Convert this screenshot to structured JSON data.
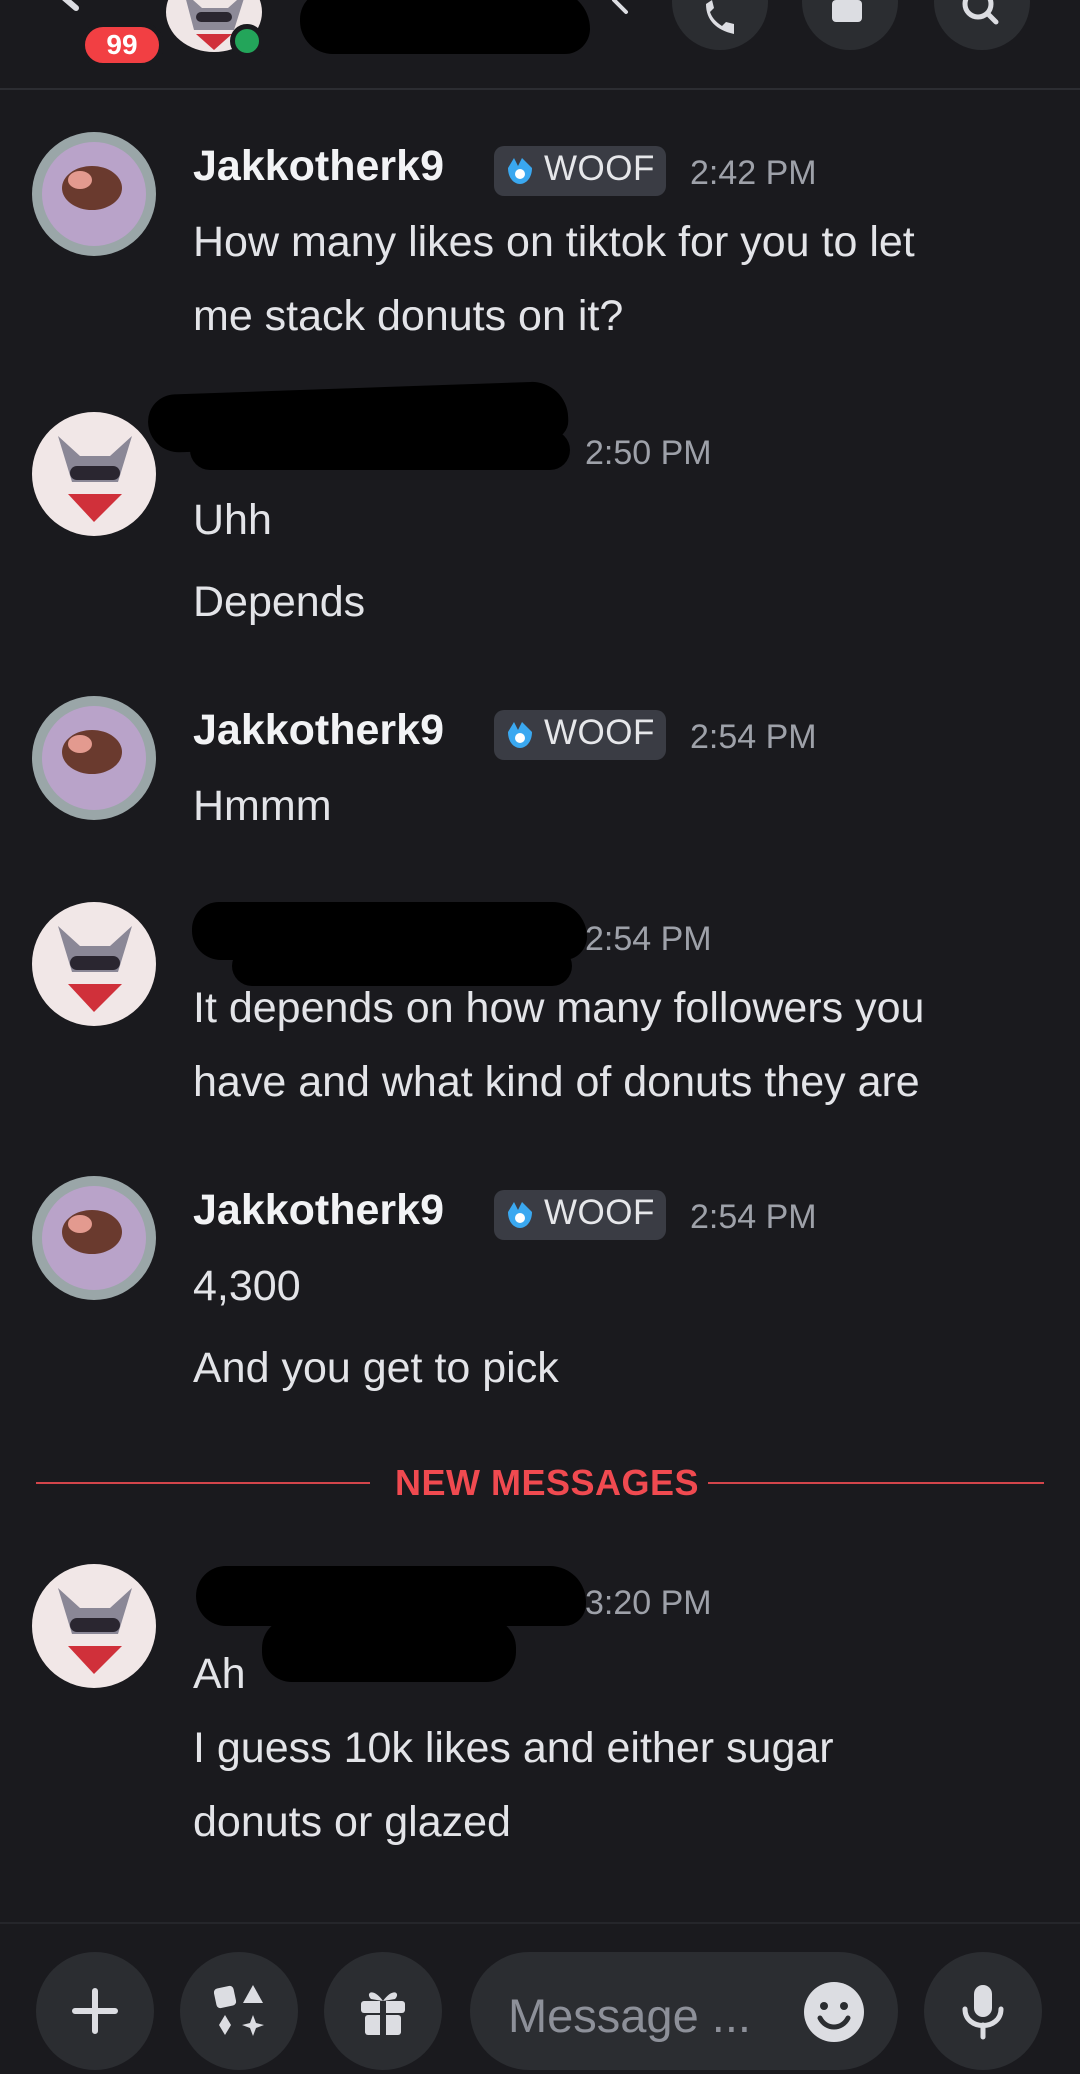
{
  "header": {
    "unread_count": "99",
    "channel_name": "",
    "status_color": "#23a55a"
  },
  "messages": [
    {
      "author": "Jakkotherk9",
      "tag": "WOOF",
      "time": "2:42 PM",
      "lines": [
        "How many likes on tiktok for you to let",
        "me stack donuts on it?"
      ]
    },
    {
      "author": "",
      "time": "2:50 PM",
      "lines": [
        "Uhh",
        "Depends"
      ]
    },
    {
      "author": "Jakkotherk9",
      "tag": "WOOF",
      "time": "2:54 PM",
      "lines": [
        "Hmmm"
      ]
    },
    {
      "author": "",
      "time": "2:54 PM",
      "lines": [
        "It depends on how many followers you",
        "have and what kind of donuts they are"
      ]
    },
    {
      "author": "Jakkotherk9",
      "tag": "WOOF",
      "time": "2:54 PM",
      "lines": [
        "4,300",
        "And you get to pick"
      ]
    },
    {
      "author": "",
      "time": "3:20 PM",
      "lines": [
        "Ah",
        "I guess 10k likes and either sugar",
        "donuts or glazed"
      ]
    }
  ],
  "divider": {
    "label": "NEW MESSAGES",
    "color": "#f04a50"
  },
  "composer": {
    "placeholder": "Message ..."
  },
  "icons": [
    "back-arrow-icon",
    "chevron-right-icon",
    "phone-icon",
    "video-icon",
    "search-icon",
    "plus-icon",
    "apps-icon",
    "gift-icon",
    "emoji-icon",
    "microphone-icon",
    "verified-tag-icon"
  ],
  "colors": {
    "background": "#1a1a1e",
    "badge": "#f23f43",
    "tag": "#3a3c44",
    "accent_red": "#d3454b"
  }
}
